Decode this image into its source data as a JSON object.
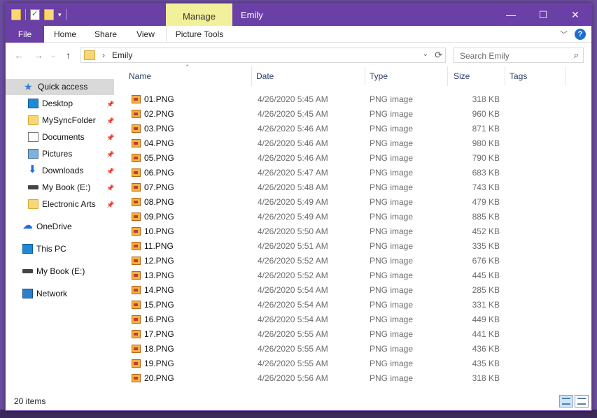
{
  "window": {
    "title": "Emily",
    "context_tab": "Manage"
  },
  "ribbon": {
    "tabs": [
      "File",
      "Home",
      "Share",
      "View",
      "Picture Tools"
    ]
  },
  "address": {
    "location": "Emily",
    "search_placeholder": "Search Emily"
  },
  "nav": {
    "quick_access": "Quick access",
    "pinned": [
      {
        "label": "Desktop",
        "icon": "desktop-icon"
      },
      {
        "label": "MySyncFolder",
        "icon": "folder-icon"
      },
      {
        "label": "Documents",
        "icon": "documents-icon"
      },
      {
        "label": "Pictures",
        "icon": "pictures-icon"
      },
      {
        "label": "Downloads",
        "icon": "downloads-icon"
      },
      {
        "label": "My Book (E:)",
        "icon": "drive-icon"
      },
      {
        "label": "Electronic Arts",
        "icon": "folder-icon"
      }
    ],
    "roots": [
      {
        "label": "OneDrive",
        "icon": "onedrive-icon"
      },
      {
        "label": "This PC",
        "icon": "this-pc-icon"
      },
      {
        "label": "My Book (E:)",
        "icon": "drive-icon"
      },
      {
        "label": "Network",
        "icon": "network-icon"
      }
    ]
  },
  "columns": {
    "name": "Name",
    "date": "Date",
    "type": "Type",
    "size": "Size",
    "tags": "Tags"
  },
  "files": [
    {
      "name": "01.PNG",
      "date": "4/26/2020 5:45 AM",
      "type": "PNG image",
      "size": "318 KB"
    },
    {
      "name": "02.PNG",
      "date": "4/26/2020 5:45 AM",
      "type": "PNG image",
      "size": "960 KB"
    },
    {
      "name": "03.PNG",
      "date": "4/26/2020 5:46 AM",
      "type": "PNG image",
      "size": "871 KB"
    },
    {
      "name": "04.PNG",
      "date": "4/26/2020 5:46 AM",
      "type": "PNG image",
      "size": "980 KB"
    },
    {
      "name": "05.PNG",
      "date": "4/26/2020 5:46 AM",
      "type": "PNG image",
      "size": "790 KB"
    },
    {
      "name": "06.PNG",
      "date": "4/26/2020 5:47 AM",
      "type": "PNG image",
      "size": "683 KB"
    },
    {
      "name": "07.PNG",
      "date": "4/26/2020 5:48 AM",
      "type": "PNG image",
      "size": "743 KB"
    },
    {
      "name": "08.PNG",
      "date": "4/26/2020 5:49 AM",
      "type": "PNG image",
      "size": "479 KB"
    },
    {
      "name": "09.PNG",
      "date": "4/26/2020 5:49 AM",
      "type": "PNG image",
      "size": "885 KB"
    },
    {
      "name": "10.PNG",
      "date": "4/26/2020 5:50 AM",
      "type": "PNG image",
      "size": "452 KB"
    },
    {
      "name": "11.PNG",
      "date": "4/26/2020 5:51 AM",
      "type": "PNG image",
      "size": "335 KB"
    },
    {
      "name": "12.PNG",
      "date": "4/26/2020 5:52 AM",
      "type": "PNG image",
      "size": "676 KB"
    },
    {
      "name": "13.PNG",
      "date": "4/26/2020 5:52 AM",
      "type": "PNG image",
      "size": "445 KB"
    },
    {
      "name": "14.PNG",
      "date": "4/26/2020 5:54 AM",
      "type": "PNG image",
      "size": "285 KB"
    },
    {
      "name": "15.PNG",
      "date": "4/26/2020 5:54 AM",
      "type": "PNG image",
      "size": "331 KB"
    },
    {
      "name": "16.PNG",
      "date": "4/26/2020 5:54 AM",
      "type": "PNG image",
      "size": "449 KB"
    },
    {
      "name": "17.PNG",
      "date": "4/26/2020 5:55 AM",
      "type": "PNG image",
      "size": "441 KB"
    },
    {
      "name": "18.PNG",
      "date": "4/26/2020 5:55 AM",
      "type": "PNG image",
      "size": "436 KB"
    },
    {
      "name": "19.PNG",
      "date": "4/26/2020 5:55 AM",
      "type": "PNG image",
      "size": "435 KB"
    },
    {
      "name": "20.PNG",
      "date": "4/26/2020 5:56 AM",
      "type": "PNG image",
      "size": "318 KB"
    }
  ],
  "status": {
    "item_count": "20 items"
  },
  "colors": {
    "accent": "#6a3fa6",
    "manage_tab": "#f2f09a",
    "selection": "#d9d9d9"
  }
}
